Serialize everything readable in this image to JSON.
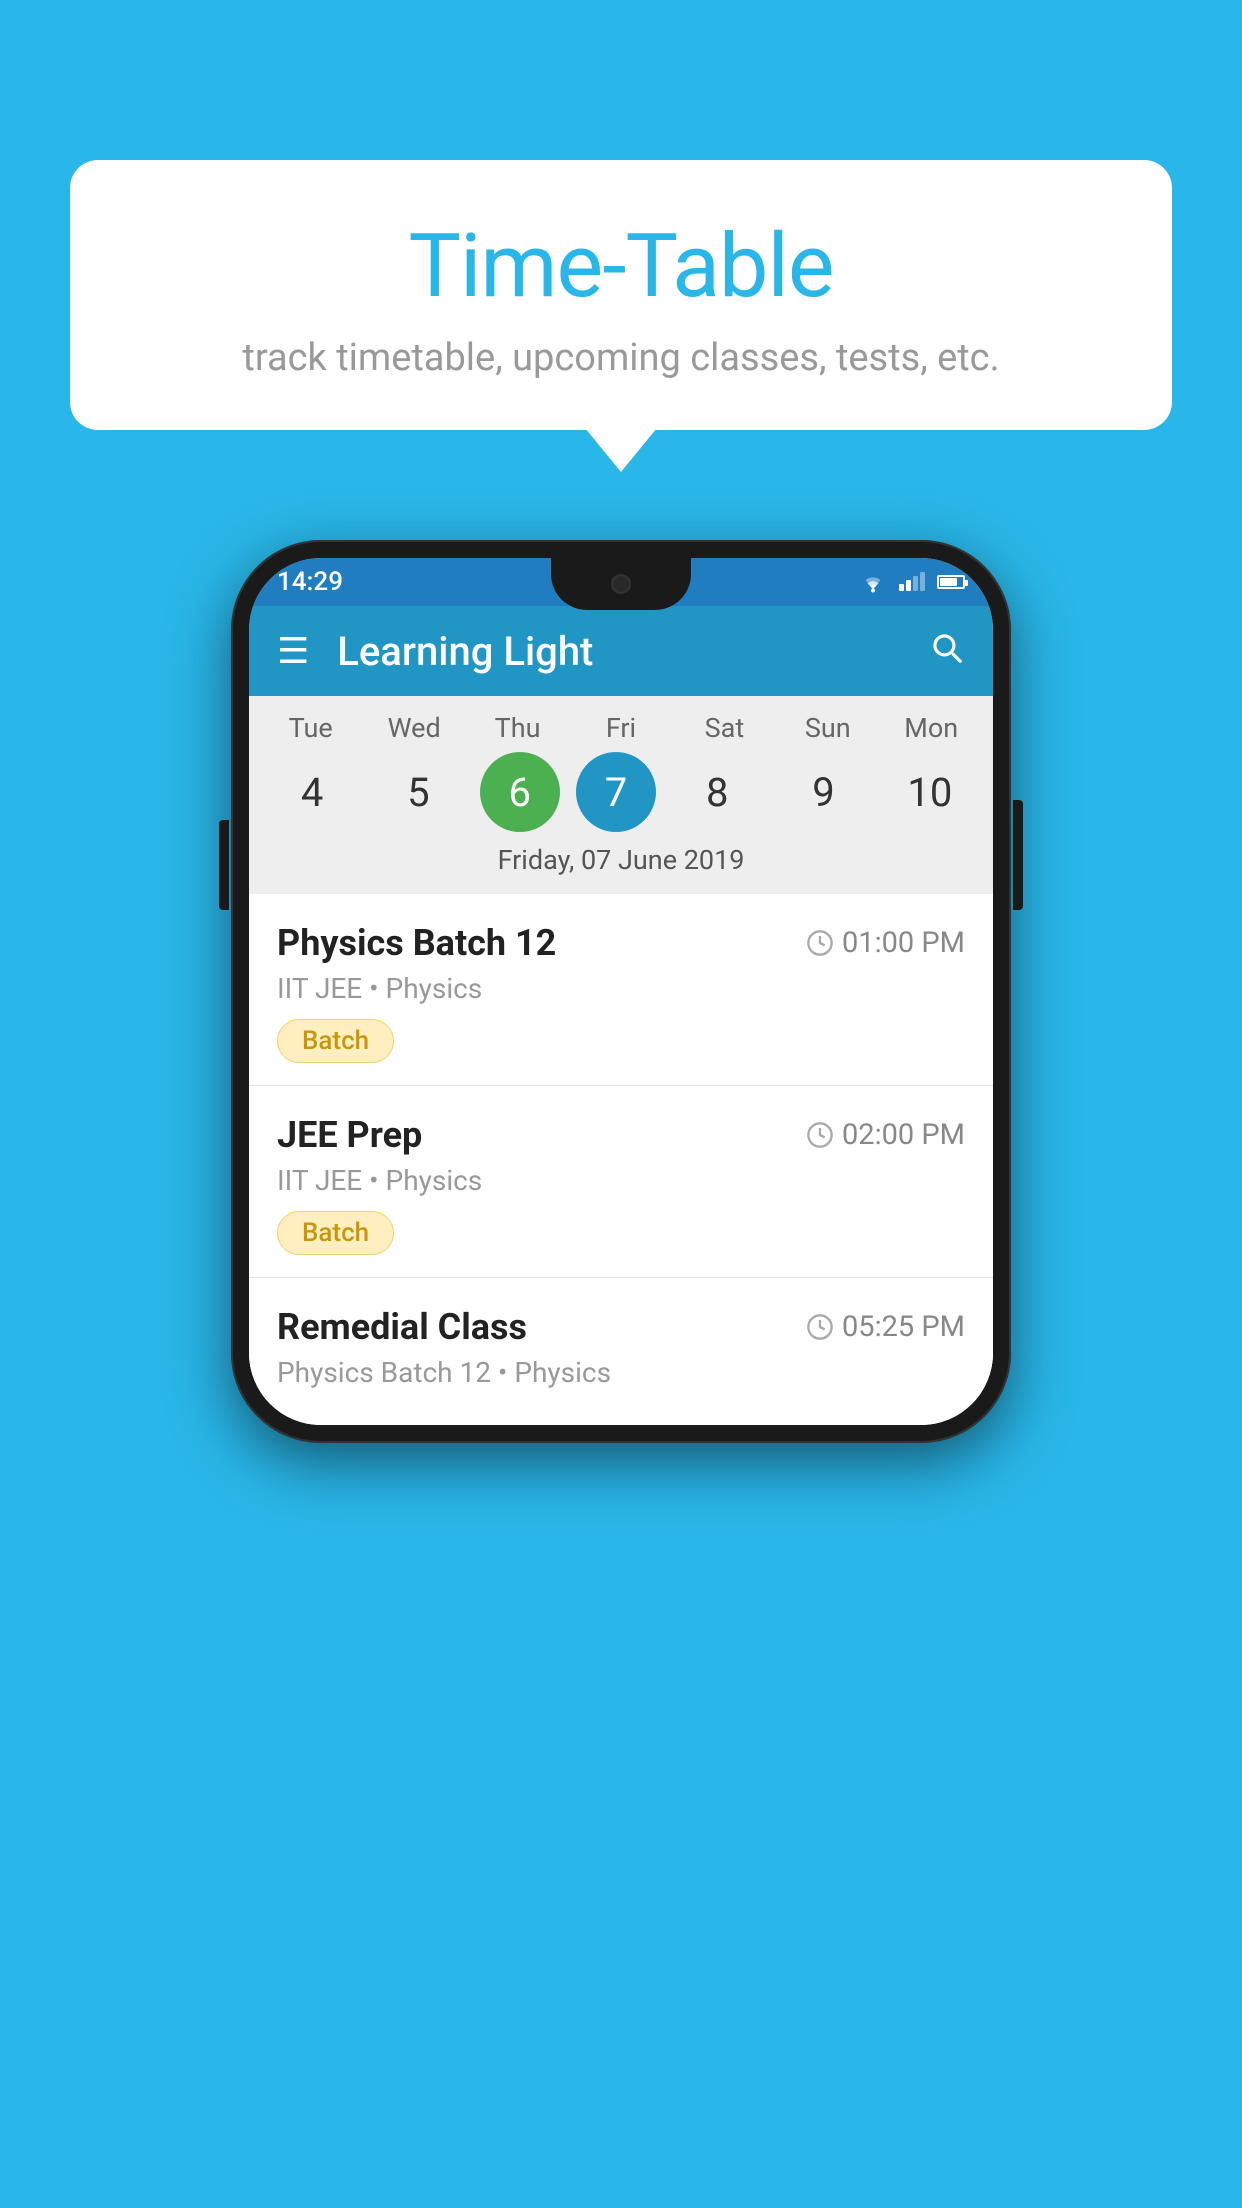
{
  "background_color": "#29b6e8",
  "bubble": {
    "title": "Time-Table",
    "subtitle": "track timetable, upcoming classes, tests, etc."
  },
  "phone": {
    "status_bar": {
      "time": "14:29"
    },
    "app_bar": {
      "title": "Learning Light"
    },
    "calendar": {
      "days": [
        {
          "label": "Tue",
          "number": "4"
        },
        {
          "label": "Wed",
          "number": "5"
        },
        {
          "label": "Thu",
          "number": "6",
          "state": "today"
        },
        {
          "label": "Fri",
          "number": "7",
          "state": "selected"
        },
        {
          "label": "Sat",
          "number": "8"
        },
        {
          "label": "Sun",
          "number": "9"
        },
        {
          "label": "Mon",
          "number": "10"
        }
      ],
      "selected_date": "Friday, 07 June 2019"
    },
    "classes": [
      {
        "name": "Physics Batch 12",
        "time": "01:00 PM",
        "meta": "IIT JEE • Physics",
        "badge": "Batch"
      },
      {
        "name": "JEE Prep",
        "time": "02:00 PM",
        "meta": "IIT JEE • Physics",
        "badge": "Batch"
      },
      {
        "name": "Remedial Class",
        "time": "05:25 PM",
        "meta": "Physics Batch 12 • Physics",
        "badge": null
      }
    ]
  }
}
